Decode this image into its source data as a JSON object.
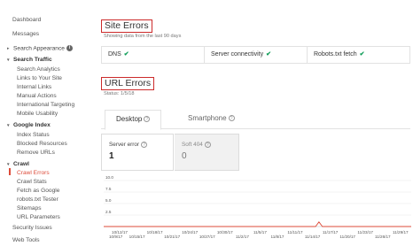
{
  "sidebar": {
    "items": [
      {
        "label": "Dashboard"
      },
      {
        "label": "Messages"
      },
      {
        "label": "Search Appearance"
      },
      {
        "label": "Search Traffic"
      },
      {
        "label": "Search Analytics"
      },
      {
        "label": "Links to Your Site"
      },
      {
        "label": "Internal Links"
      },
      {
        "label": "Manual Actions"
      },
      {
        "label": "International Targeting"
      },
      {
        "label": "Mobile Usability"
      },
      {
        "label": "Google Index"
      },
      {
        "label": "Index Status"
      },
      {
        "label": "Blocked Resources"
      },
      {
        "label": "Remove URLs"
      },
      {
        "label": "Crawl"
      },
      {
        "label": "Crawl Errors"
      },
      {
        "label": "Crawl Stats"
      },
      {
        "label": "Fetch as Google"
      },
      {
        "label": "robots.txt Tester"
      },
      {
        "label": "Sitemaps"
      },
      {
        "label": "URL Parameters"
      },
      {
        "label": "Security Issues"
      },
      {
        "label": "Web Tools"
      }
    ],
    "info_icon": "i",
    "expand_icon": "▸",
    "collapse_icon": "▾"
  },
  "site_errors": {
    "title": "Site Errors",
    "subtitle": "Showing data from the last 90 days",
    "checks": [
      {
        "label": "DNS",
        "icon": "check-icon"
      },
      {
        "label": "Server connectivity",
        "icon": "check-icon"
      },
      {
        "label": "Robots.txt fetch",
        "icon": "check-icon"
      }
    ],
    "check_glyph": "✔"
  },
  "url_errors": {
    "title": "URL Errors",
    "status": "Status: 1/5/18",
    "tabs": [
      {
        "label": "Desktop"
      },
      {
        "label": "Smartphone"
      }
    ],
    "help_glyph": "?",
    "metrics": [
      {
        "label": "Server error",
        "value": "1"
      },
      {
        "label": "Soft 404",
        "value": "0"
      }
    ]
  },
  "colors": {
    "accent_red": "#dd4b39",
    "title_box": "#cc2b2b",
    "check_green": "#0f9d58",
    "line_red": "#dd4b39"
  },
  "chart_data": {
    "type": "line",
    "yticks": [
      "10.0",
      "7.5",
      "5.0",
      "2.5"
    ],
    "ylim": [
      0,
      10
    ],
    "x_upper": [
      "10/12/17",
      "10/18/17",
      "10/24/17",
      "10/30/17",
      "11/5/17",
      "11/11/17",
      "11/17/17",
      "11/23/17",
      "11/29/17"
    ],
    "x_lower": [
      "10/9/17",
      "10/15/17",
      "10/21/17",
      "10/27/17",
      "11/2/17",
      "11/8/17",
      "11/14/17",
      "11/20/17",
      "11/26/17",
      "1"
    ],
    "series": [
      {
        "values": [
          0,
          0,
          0,
          0,
          0,
          0,
          0,
          0,
          0,
          0,
          0,
          0,
          0,
          0,
          0,
          0,
          0,
          0,
          0,
          0,
          0,
          0,
          0,
          0,
          0,
          0,
          0,
          0,
          0,
          0,
          0,
          0,
          0,
          0,
          0,
          0,
          0,
          0,
          0,
          0,
          0,
          0,
          0,
          0,
          0,
          0,
          0,
          0,
          0,
          0,
          0,
          0,
          0,
          0,
          0,
          0,
          0,
          0,
          0,
          0,
          0,
          0,
          0,
          1,
          0,
          0,
          0,
          0,
          0,
          0,
          0,
          0,
          0,
          0,
          0,
          0,
          0,
          0,
          0,
          0,
          0,
          0,
          0,
          0,
          0,
          0,
          0,
          0,
          0,
          0,
          0
        ]
      }
    ]
  }
}
